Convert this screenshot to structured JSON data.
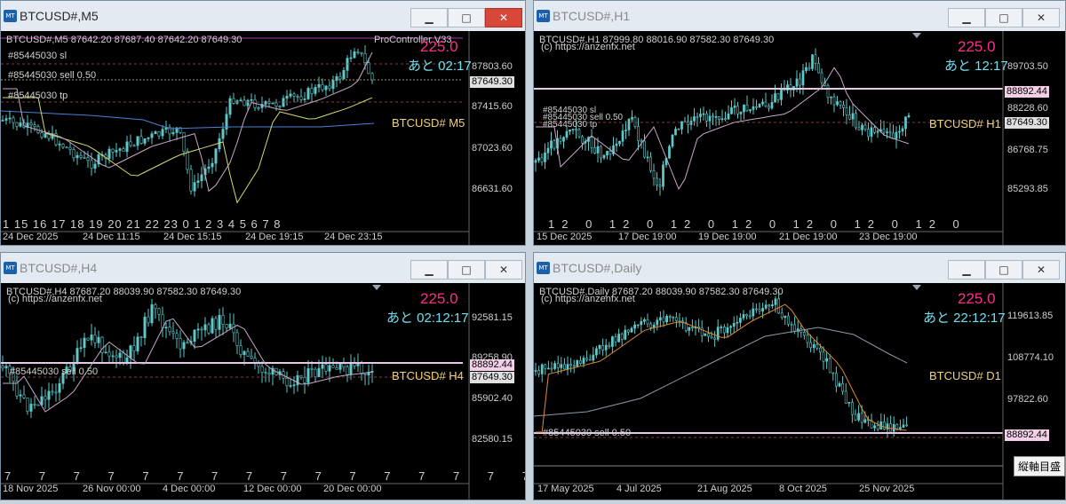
{
  "windows": [
    {
      "title": "BTCUSD#,M5",
      "active": true,
      "header": "BTCUSD#,M5  87642.20 87687.40 87642.20 87649.30",
      "indicator": "ProController V33",
      "sl_label": "#85445030 sl",
      "sell_label": "#85445030 sell 0.50",
      "tp_label": "#85445030 tp",
      "loss": "225.0",
      "time_left": "あと 02:17",
      "symbol_label": "BTCUSD# M5",
      "price_axis": [
        "87803.60",
        "87415.60",
        "87023.60",
        "86631.60"
      ],
      "current_price": "87649.30",
      "hours_row": "1 15 16 17 18 19 20 21 22 23 0 1 2 3 4 5 6 7 8",
      "x_labels": [
        "24 Dec 2025",
        "24 Dec 11:15",
        "24 Dec 15:15",
        "24 Dec 19:15",
        "24 Dec 23:15"
      ]
    },
    {
      "title": "BTCUSD#,H1",
      "active": false,
      "header": "BTCUSD#,H1  87999.80 88016.90 87582.30 87649.30",
      "watermark": "(c) https://anzenfx.net",
      "overlay": "#85445030 sl\n#85445030 sell 0.50\n#85445030 tp",
      "loss": "225.0",
      "time_left": "あと 12:17",
      "symbol_label": "BTCUSD# H1",
      "price_axis": [
        "89703.50",
        "88228.60",
        "86768.75",
        "85293.85"
      ],
      "line_price": "88892.44",
      "current_price": "87649.30",
      "hours_row": "12 0 12 0 12 0 12 0 12 0 12 0 12 0",
      "x_labels": [
        "15 Dec 2025",
        "17 Dec 19:00",
        "19 Dec 19:00",
        "21 Dec 19:00",
        "23 Dec 19:00"
      ]
    },
    {
      "title": "BTCUSD#,H4",
      "active": false,
      "header": "BTCUSD#,H4  87687.20 88039.90 87582.30 87649.30",
      "watermark": "(c) https://anzenfx.net",
      "overlay": "#85445030 sell 0.50",
      "loss": "225.0",
      "time_left": "あと 02:12:17",
      "symbol_label": "BTCUSD# H4",
      "price_axis": [
        "92581.15",
        "89258.90",
        "85902.40",
        "82580.15"
      ],
      "line_price": "88892.44",
      "current_price": "87649.30",
      "hours_row": "7 7 7 7 7 7 7 7 7 7 7 7 7 7 7 7 7",
      "x_labels": [
        "18 Nov 2025",
        "26 Nov 00:00",
        "4 Dec 00:00",
        "12 Dec 00:00",
        "20 Dec 00:00"
      ]
    },
    {
      "title": "BTCUSD#,Daily",
      "active": false,
      "header": "BTCUSD#,Daily  87687.20 88039.90 87582.30 87649.30",
      "watermark": "(c) https://anzenfx.net",
      "overlay": "#85445030 sell 0.50",
      "loss": "225.0",
      "time_left": "あと 22:12:17",
      "symbol_label": "BTCUSD# D1",
      "price_axis": [
        "119613.85",
        "108774.10",
        "97822.60"
      ],
      "line_price": "88892.44",
      "x_labels": [
        "17 May 2025",
        "4 Jul 2025",
        "21 Aug 2025",
        "8 Oct 2025",
        "25 Nov 2025"
      ],
      "tooltip": "縦軸目盛"
    }
  ],
  "colors": {
    "candle": "#5fc9c9",
    "loss": "#ff2d8a",
    "time_left": "#6ee0f0",
    "symbol": "#f0d27a",
    "ma_fast": "#c8a8c8",
    "ma_slow": "#4a82d4",
    "ma_yellow": "#d8d86a",
    "ma_orange": "#e08a30"
  },
  "icons": [
    "chart-window-icon",
    "minimize-icon",
    "maximize-icon",
    "close-icon"
  ]
}
